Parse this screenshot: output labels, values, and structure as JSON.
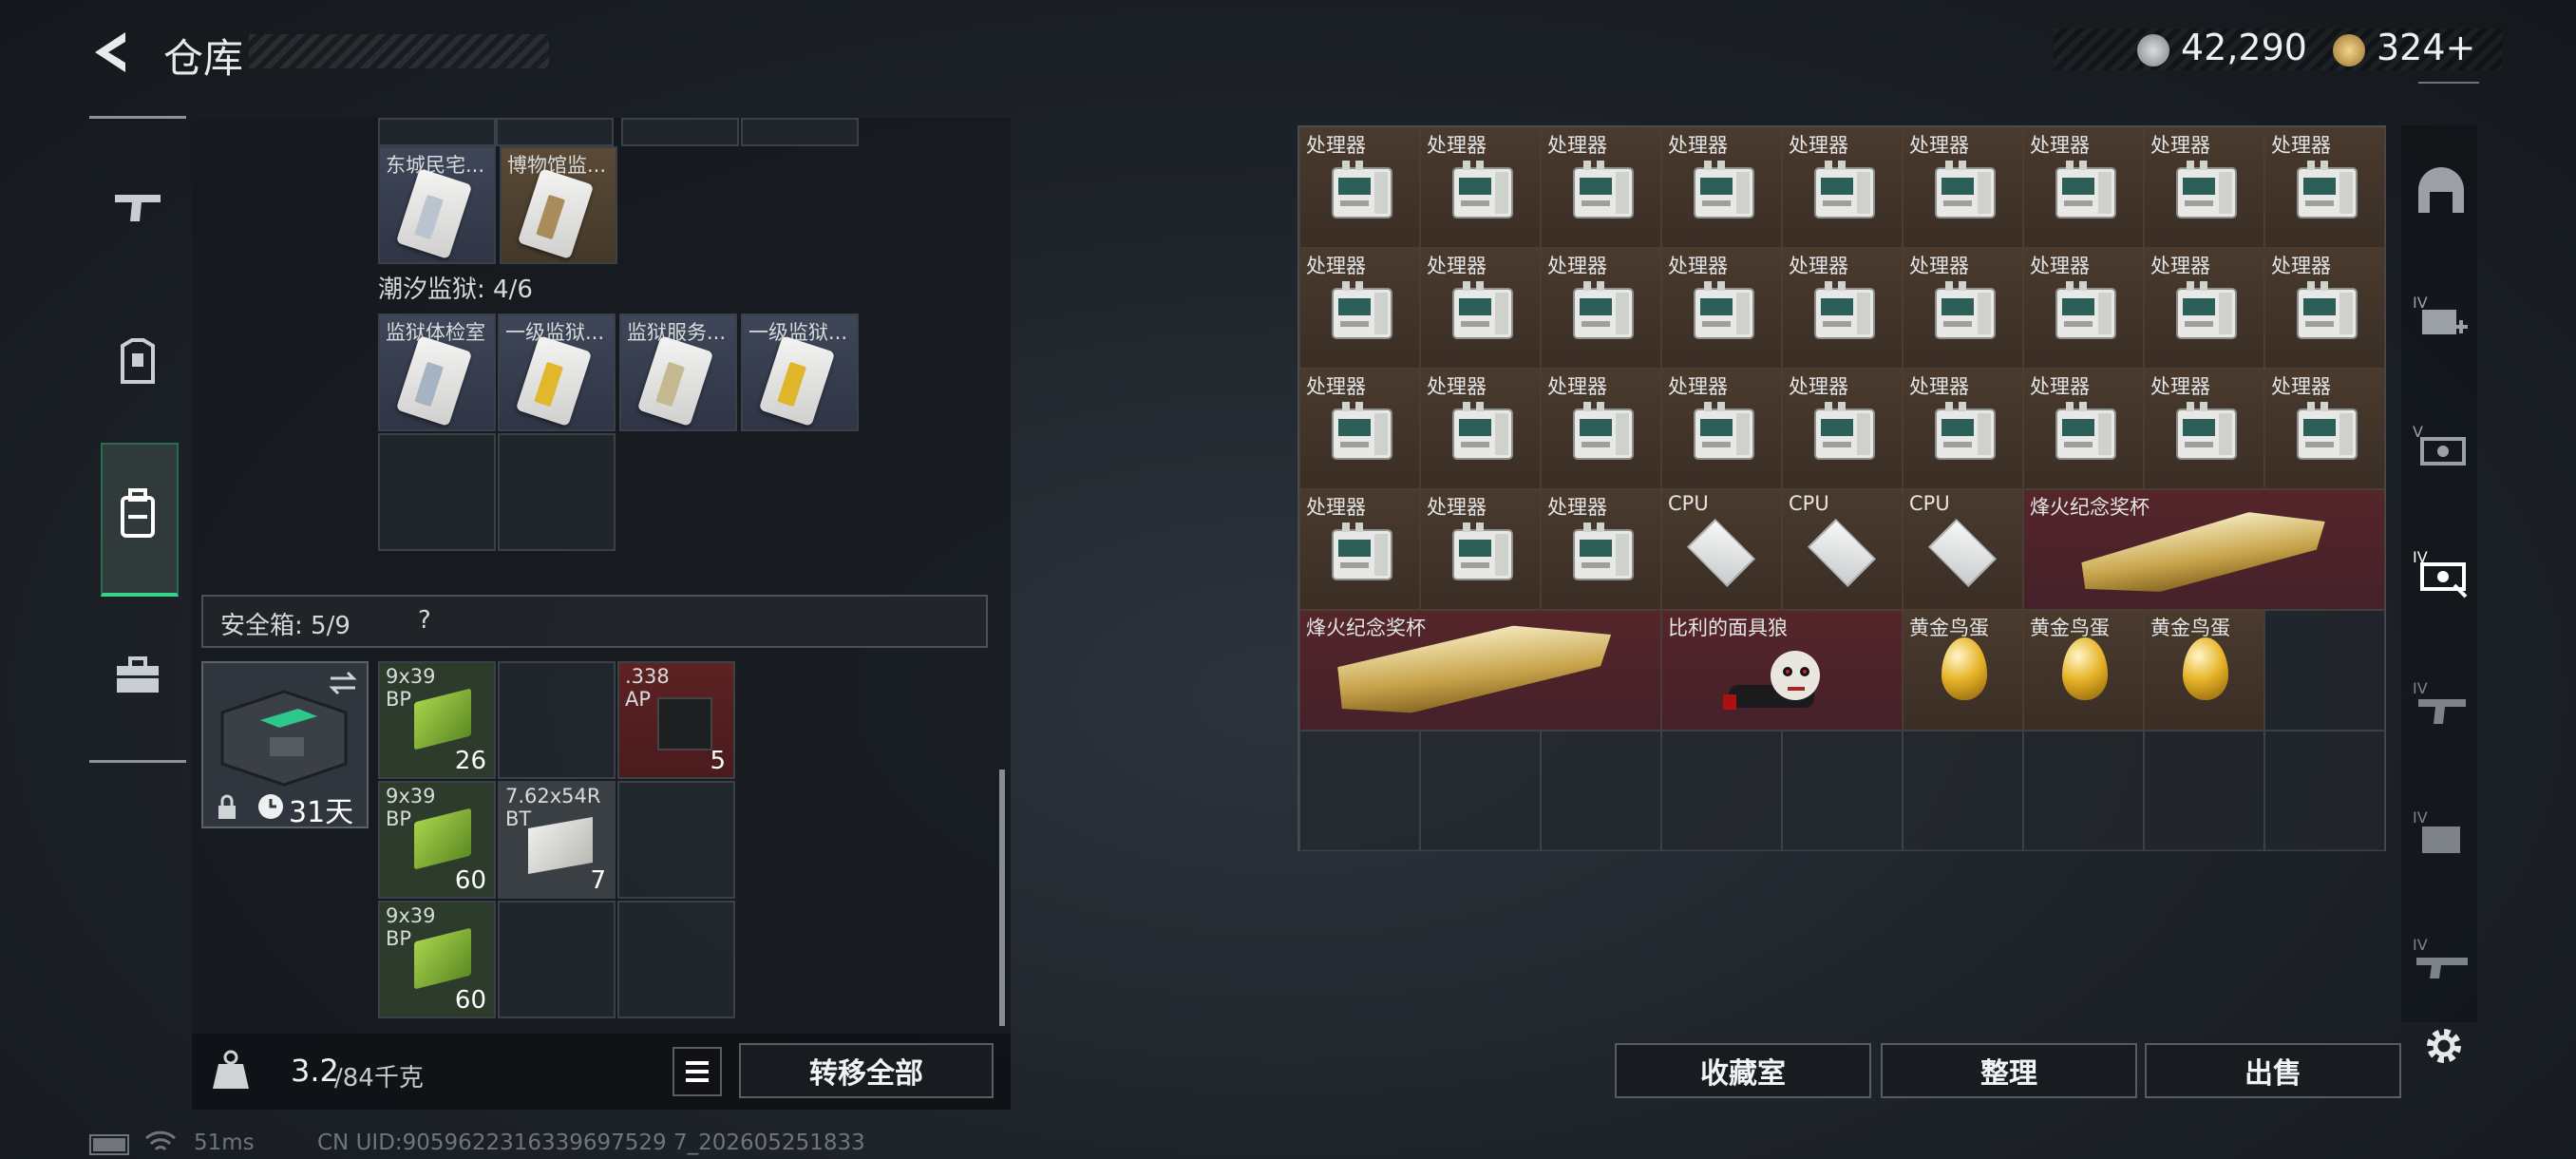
{
  "header": {
    "title": "仓库",
    "currency1": "42,290",
    "currency2": "324+"
  },
  "left_panel": {
    "row1": [
      {
        "label": "东城民宅..."
      },
      {
        "label": "博物馆监..."
      }
    ],
    "prison_label": "潮汐监狱: 4/6",
    "row2": [
      {
        "label": "监狱体检室"
      },
      {
        "label": "一级监狱..."
      },
      {
        "label": "监狱服务..."
      },
      {
        "label": "一级监狱..."
      }
    ],
    "safe_label": "安全箱: 5/9",
    "safe_help": "?",
    "safe_days": "31天",
    "ammo": [
      {
        "label": "9x39\nBP",
        "count": "26"
      },
      {
        "label": ".338\nAP",
        "count": "5"
      },
      {
        "label": "9x39\nBP",
        "count": "60"
      },
      {
        "label": "7.62x54R\nBT",
        "count": "7"
      },
      {
        "label": "9x39\nBP",
        "count": "60"
      }
    ],
    "weight_value": "3.2",
    "weight_max": "/84千克",
    "transfer_all": "转移全部"
  },
  "right_panel": {
    "processor_label": "处理器",
    "cpu_label": "CPU",
    "trophy_label": "烽火纪念奖杯",
    "saw_label": "比利的面具狼",
    "egg_label": "黄金鸟蛋",
    "buttons": {
      "collection": "收藏室",
      "organize": "整理",
      "sell": "出售"
    }
  },
  "status_bar": {
    "ping": "51ms",
    "uid": "CN UID:9059622316339697529 7_202605251833"
  }
}
